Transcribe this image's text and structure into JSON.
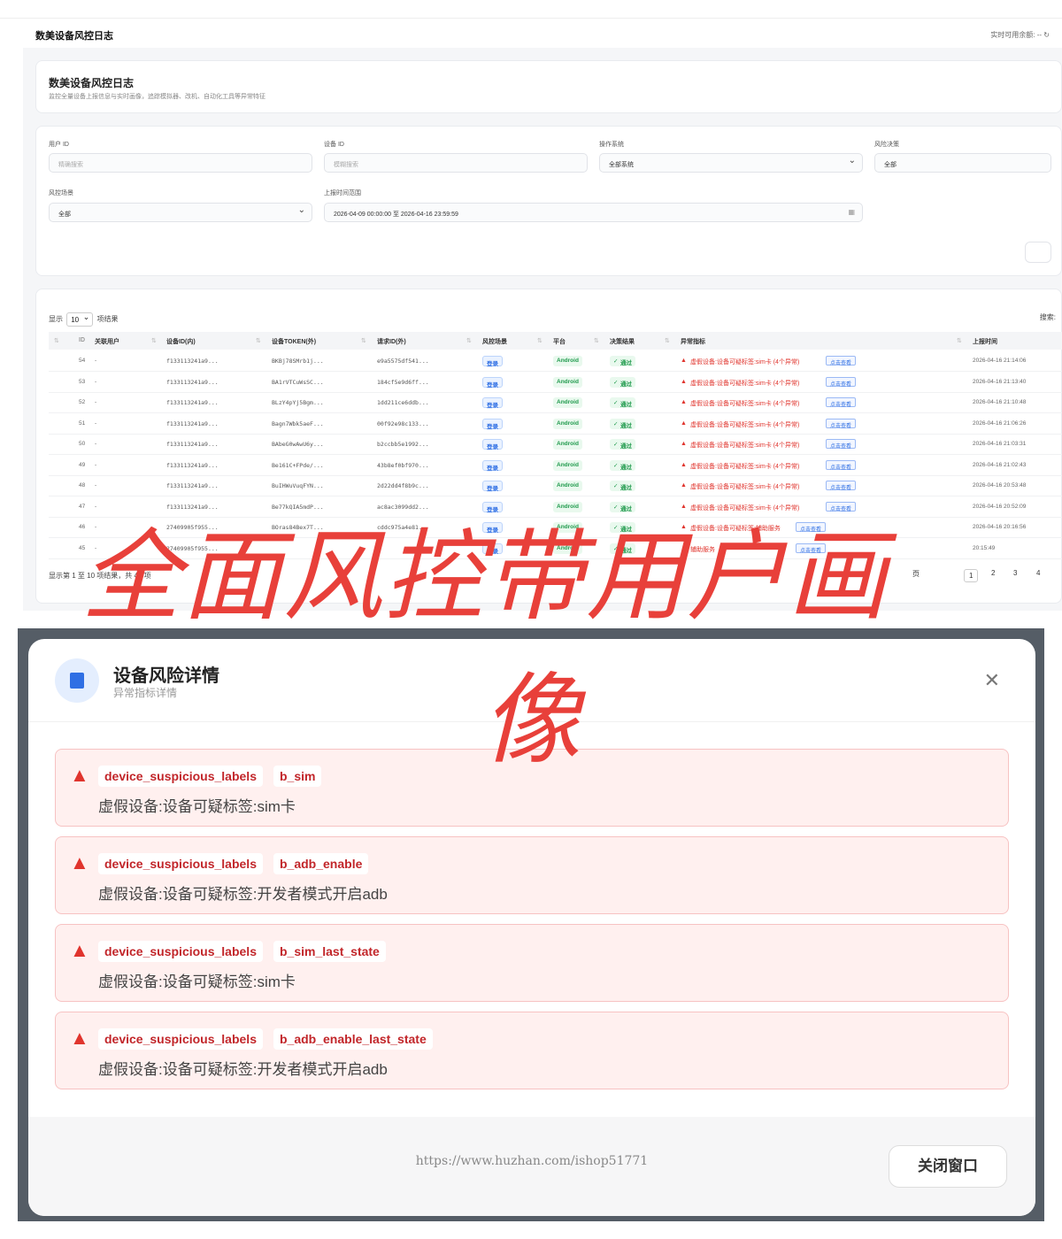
{
  "app": {
    "name": "数美设备风控日志",
    "balance_label": "实时可用余额: --",
    "refresh_icon": "refresh-icon"
  },
  "header": {
    "title": "数美设备风控日志",
    "subtitle": "监控全量设备上报信息与实时画像，追踪模拟器、改机、自动化工具等异常特征"
  },
  "filters": {
    "user_id": {
      "label": "用户 ID",
      "placeholder": "精确搜索"
    },
    "device_id": {
      "label": "设备 ID",
      "placeholder": "模糊搜索"
    },
    "os": {
      "label": "操作系统",
      "value": "全部系统"
    },
    "decision": {
      "label": "风险决策",
      "value": "全部"
    },
    "scene": {
      "label": "风控场景",
      "value": "全部"
    },
    "time_range": {
      "label": "上报时间范围",
      "value": "2026-04-09 00:00:00 至 2026-04-16 23:59:59"
    }
  },
  "table": {
    "show_label": "显示",
    "page_size": "10",
    "entries_label": "项结果",
    "search_label": "搜索:",
    "columns": [
      "ID",
      "关联用户",
      "设备ID(内)",
      "设备TOKEN(外)",
      "请求ID(外)",
      "风控场景",
      "平台",
      "决策结果",
      "异常指标",
      "上报时间"
    ],
    "rows": [
      {
        "id": "54",
        "user": "-",
        "device": "f133113241a9...",
        "token": "BKBj78SMrb1j...",
        "req": "e9a5575df541...",
        "scene": "登录",
        "platform": "Android",
        "decision": "通过",
        "abn": "虚假设备:设备可疑标签:sim卡 (4个异常)",
        "view": "点击查看",
        "time": "2026-04-16 21:14:06"
      },
      {
        "id": "53",
        "user": "-",
        "device": "f133113241a9...",
        "token": "BA1rVTCuWsSC...",
        "req": "184cf5e9d6ff...",
        "scene": "登录",
        "platform": "Android",
        "decision": "通过",
        "abn": "虚假设备:设备可疑标签:sim卡 (4个异常)",
        "view": "点击查看",
        "time": "2026-04-16 21:13:40"
      },
      {
        "id": "52",
        "user": "-",
        "device": "f133113241a9...",
        "token": "BLzY4pYj5Bgm...",
        "req": "1dd211ce6ddb...",
        "scene": "登录",
        "platform": "Android",
        "decision": "通过",
        "abn": "虚假设备:设备可疑标签:sim卡 (4个异常)",
        "view": "点击查看",
        "time": "2026-04-16 21:10:48"
      },
      {
        "id": "51",
        "user": "-",
        "device": "f133113241a9...",
        "token": "Bagn7Wbk5aeF...",
        "req": "00f92e98c133...",
        "scene": "登录",
        "platform": "Android",
        "decision": "通过",
        "abn": "虚假设备:设备可疑标签:sim卡 (4个异常)",
        "view": "点击查看",
        "time": "2026-04-16 21:06:26"
      },
      {
        "id": "50",
        "user": "-",
        "device": "f133113241a9...",
        "token": "BAbeG0wAwU6y...",
        "req": "b2ccbb5e1992...",
        "scene": "登录",
        "platform": "Android",
        "decision": "通过",
        "abn": "虚假设备:设备可疑标签:sim卡 (4个异常)",
        "view": "点击查看",
        "time": "2026-04-16 21:03:31"
      },
      {
        "id": "49",
        "user": "-",
        "device": "f133113241a9...",
        "token": "Be161C+FPde/...",
        "req": "43b8ef0bf970...",
        "scene": "登录",
        "platform": "Android",
        "decision": "通过",
        "abn": "虚假设备:设备可疑标签:sim卡 (4个异常)",
        "view": "点击查看",
        "time": "2026-04-16 21:02:43"
      },
      {
        "id": "48",
        "user": "-",
        "device": "f133113241a9...",
        "token": "BuIHWuVuqFYN...",
        "req": "2d22dd4f8b9c...",
        "scene": "登录",
        "platform": "Android",
        "decision": "通过",
        "abn": "虚假设备:设备可疑标签:sim卡 (4个异常)",
        "view": "点击查看",
        "time": "2026-04-16 20:53:48"
      },
      {
        "id": "47",
        "user": "-",
        "device": "f133113241a9...",
        "token": "Be77kQIA5mdP...",
        "req": "ac8ac3099dd2...",
        "scene": "登录",
        "platform": "Android",
        "decision": "通过",
        "abn": "虚假设备:设备可疑标签:sim卡 (4个异常)",
        "view": "点击查看",
        "time": "2026-04-16 20:52:09"
      },
      {
        "id": "46",
        "user": "-",
        "device": "27409905f955...",
        "token": "BOras84Bex7T...",
        "req": "cddc975a4e81...",
        "scene": "登录",
        "platform": "Android",
        "decision": "通过",
        "abn": "虚假设备:设备可疑标签:辅助服务",
        "view": "点击查看",
        "time": "2026-04-16 20:16:56"
      },
      {
        "id": "45",
        "user": "-",
        "device": "27409905f955...",
        "token": "",
        "req": "",
        "scene": "登录",
        "platform": "Android",
        "decision": "通过",
        "abn": "辅助服务",
        "view": "点击查看",
        "time": "20:15:49"
      }
    ],
    "footer": "显示第 1 至 10 项结果，共 43 项",
    "pages": [
      "页",
      "1",
      "2",
      "3",
      "4"
    ]
  },
  "watermark": {
    "line1": "全面风控带用户画",
    "line2": "像"
  },
  "modal": {
    "title": "设备风险详情",
    "subtitle": "异常指标详情",
    "icon": "chip-icon",
    "close_icon": "close-icon",
    "items": [
      {
        "key": "device_suspicious_labels",
        "code": "b_sim",
        "desc": "虚假设备:设备可疑标签:sim卡"
      },
      {
        "key": "device_suspicious_labels",
        "code": "b_adb_enable",
        "desc": "虚假设备:设备可疑标签:开发者模式开启adb"
      },
      {
        "key": "device_suspicious_labels",
        "code": "b_sim_last_state",
        "desc": "虚假设备:设备可疑标签:sim卡"
      },
      {
        "key": "device_suspicious_labels",
        "code": "b_adb_enable_last_state",
        "desc": "虚假设备:设备可疑标签:开发者模式开启adb"
      }
    ],
    "url": "https://www.huzhan.com/ishop51771",
    "close_button": "关闭窗口"
  },
  "colors": {
    "danger": "#e0342d",
    "primary": "#2f6fe4",
    "success": "#1f9a4c"
  }
}
